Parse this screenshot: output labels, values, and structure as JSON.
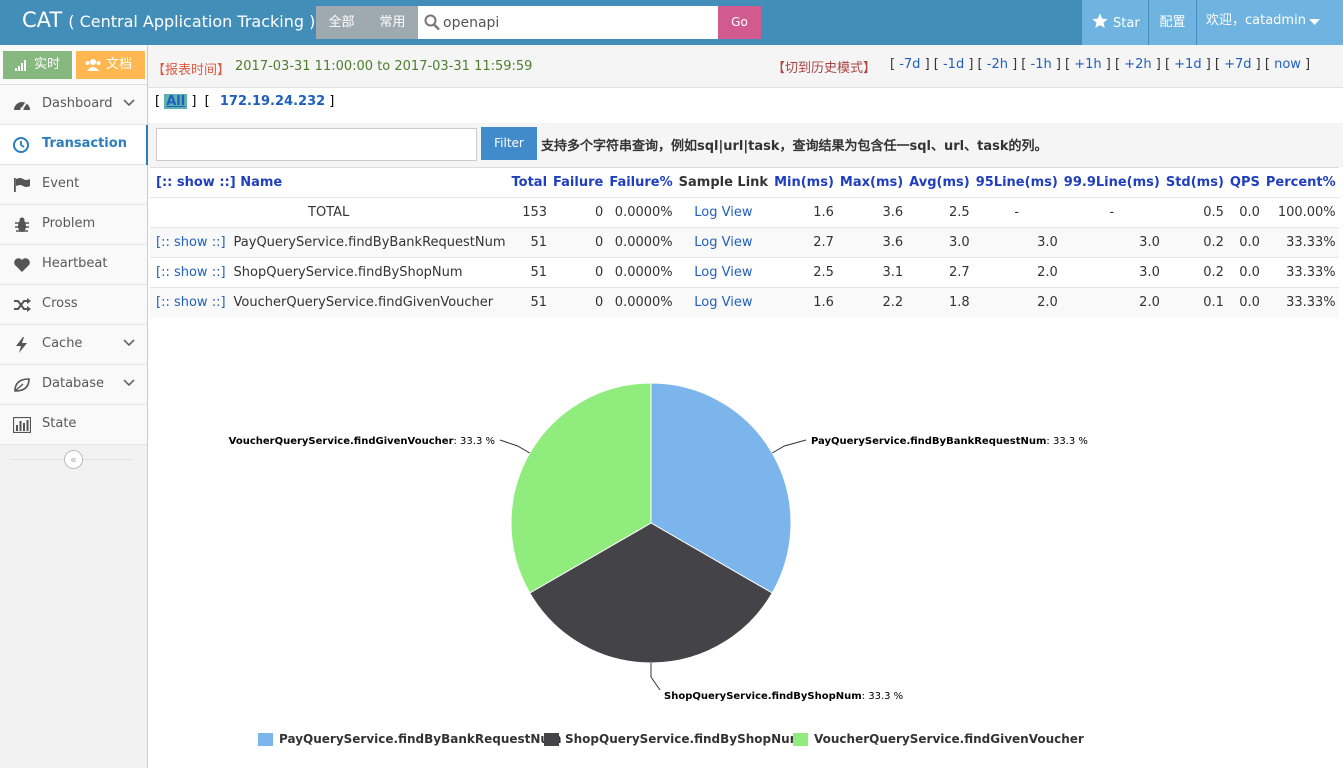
{
  "header": {
    "brand": "CAT",
    "brand_sub": "( Central Application Tracking )",
    "scope_all": "全部",
    "scope_common": "常用",
    "search_value": "openapi",
    "go_label": "Go",
    "star_label": "Star",
    "config_label": "配置",
    "welcome_label": "欢迎，catadmin"
  },
  "sidebar": {
    "realtime_label": "实时",
    "docs_label": "文档",
    "items": [
      {
        "label": "Dashboard",
        "icon": "dashboard-icon",
        "caret": true
      },
      {
        "label": "Transaction",
        "icon": "clock-icon",
        "active": true
      },
      {
        "label": "Event",
        "icon": "flag-icon"
      },
      {
        "label": "Problem",
        "icon": "bug-icon"
      },
      {
        "label": "Heartbeat",
        "icon": "heart-icon"
      },
      {
        "label": "Cross",
        "icon": "shuffle-icon"
      },
      {
        "label": "Cache",
        "icon": "bolt-icon",
        "caret": true
      },
      {
        "label": "Database",
        "icon": "leaf-icon",
        "caret": true
      },
      {
        "label": "State",
        "icon": "bar-chart-icon"
      }
    ]
  },
  "report": {
    "time_label": "【报表时间】",
    "time_value": "2017-03-31 11:00:00 to 2017-03-31 11:59:59",
    "history_label": "【切到历史模式】",
    "time_links": [
      "-7d",
      "-1d",
      "-2h",
      "-1h",
      "+1h",
      "+2h",
      "+1d",
      "+7d",
      "now"
    ]
  },
  "ips": {
    "all": "All",
    "ip": "172.19.24.232"
  },
  "filter": {
    "button": "Filter",
    "hint": "支持多个字符串查询，例如sql|url|task，查询结果为包含任一sql、url、task的列。"
  },
  "table": {
    "show_header": "[:: show ::]",
    "columns": [
      "Name",
      "Total",
      "Failure",
      "Failure%",
      "Sample Link",
      "Min(ms)",
      "Max(ms)",
      "Avg(ms)",
      "95Line(ms)",
      "99.9Line(ms)",
      "Std(ms)",
      "QPS",
      "Percent%"
    ],
    "rows": [
      {
        "show": "",
        "name": "TOTAL",
        "total": "153",
        "failure": "0",
        "failure_pct": "0.0000%",
        "link": "Log View",
        "min": "1.6",
        "max": "3.6",
        "avg": "2.5",
        "l95": "-",
        "l999": "-",
        "std": "0.5",
        "qps": "0.0",
        "pct": "100.00%"
      },
      {
        "show": "[:: show ::]",
        "name": "PayQueryService.findByBankRequestNum",
        "total": "51",
        "failure": "0",
        "failure_pct": "0.0000%",
        "link": "Log View",
        "min": "2.7",
        "max": "3.6",
        "avg": "3.0",
        "l95": "3.0",
        "l999": "3.0",
        "std": "0.2",
        "qps": "0.0",
        "pct": "33.33%"
      },
      {
        "show": "[:: show ::]",
        "name": "ShopQueryService.findByShopNum",
        "total": "51",
        "failure": "0",
        "failure_pct": "0.0000%",
        "link": "Log View",
        "min": "2.5",
        "max": "3.1",
        "avg": "2.7",
        "l95": "2.0",
        "l999": "3.0",
        "std": "0.2",
        "qps": "0.0",
        "pct": "33.33%"
      },
      {
        "show": "[:: show ::]",
        "name": "VoucherQueryService.findGivenVoucher",
        "total": "51",
        "failure": "0",
        "failure_pct": "0.0000%",
        "link": "Log View",
        "min": "1.6",
        "max": "2.2",
        "avg": "1.8",
        "l95": "2.0",
        "l999": "2.0",
        "std": "0.1",
        "qps": "0.0",
        "pct": "33.33%"
      }
    ]
  },
  "chart_data": {
    "type": "pie",
    "legend": "bottom",
    "series": [
      {
        "name": "PayQueryService.findByBankRequestNum",
        "value": 33.3,
        "label": "PayQueryService.findByBankRequestNum",
        "pct": ": 33.3 %",
        "color": "#7cb5ec"
      },
      {
        "name": "ShopQueryService.findByShopNum",
        "value": 33.3,
        "label": "ShopQueryService.findByShopNum",
        "pct": ": 33.3 %",
        "color": "#434348"
      },
      {
        "name": "VoucherQueryService.findGivenVoucher",
        "value": 33.3,
        "label": "VoucherQueryService.findGivenVoucher",
        "pct": ": 33.3 %",
        "color": "#90ed7d"
      }
    ]
  }
}
